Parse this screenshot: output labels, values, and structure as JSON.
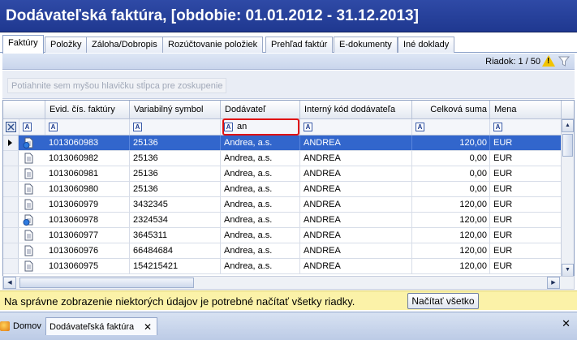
{
  "window": {
    "title": "Dodávateľská faktúra, [obdobie: 01.01.2012 - 31.12.2013]"
  },
  "tabs": [
    {
      "label": "Faktúry",
      "active": true
    },
    {
      "label": "Položky"
    },
    {
      "label": "Záloha/Dobropis"
    },
    {
      "label": "Rozúčtovanie položiek"
    },
    {
      "label": "Prehľad faktúr"
    },
    {
      "label": "E-dokumenty"
    },
    {
      "label": "Iné doklady"
    }
  ],
  "status": {
    "row_counter": "Riadok: 1 / 50"
  },
  "group_hint": "Potiahnite sem myšou hlavičku stĺpca pre zoskupenie",
  "grid": {
    "columns": [
      "Evid. čís. faktúry",
      "Variabilný symbol",
      "Dodávateľ",
      "Interný kód dodávateľa",
      "Celková suma",
      "Mena"
    ],
    "filter_value": "an",
    "filter_glyph": "A",
    "rows": [
      {
        "invoice": "1013060983",
        "vs": "25136",
        "supplier": "Andrea, a.s.",
        "code": "ANDREA",
        "sum": "120,00",
        "currency": "EUR",
        "icon": "doc-globe-icon",
        "selected": true
      },
      {
        "invoice": "1013060982",
        "vs": "25136",
        "supplier": "Andrea, a.s.",
        "code": "ANDREA",
        "sum": "0,00",
        "currency": "EUR",
        "icon": "doc-icon"
      },
      {
        "invoice": "1013060981",
        "vs": "25136",
        "supplier": "Andrea, a.s.",
        "code": "ANDREA",
        "sum": "0,00",
        "currency": "EUR",
        "icon": "doc-icon"
      },
      {
        "invoice": "1013060980",
        "vs": "25136",
        "supplier": "Andrea, a.s.",
        "code": "ANDREA",
        "sum": "0,00",
        "currency": "EUR",
        "icon": "doc-icon"
      },
      {
        "invoice": "1013060979",
        "vs": "3432345",
        "supplier": "Andrea, a.s.",
        "code": "ANDREA",
        "sum": "120,00",
        "currency": "EUR",
        "icon": "doc-icon"
      },
      {
        "invoice": "1013060978",
        "vs": "2324534",
        "supplier": "Andrea, a.s.",
        "code": "ANDREA",
        "sum": "120,00",
        "currency": "EUR",
        "icon": "doc-globe-icon"
      },
      {
        "invoice": "1013060977",
        "vs": "3645311",
        "supplier": "Andrea, a.s.",
        "code": "ANDREA",
        "sum": "120,00",
        "currency": "EUR",
        "icon": "doc-icon"
      },
      {
        "invoice": "1013060976",
        "vs": "66484684",
        "supplier": "Andrea, a.s.",
        "code": "ANDREA",
        "sum": "120,00",
        "currency": "EUR",
        "icon": "doc-icon"
      },
      {
        "invoice": "1013060975",
        "vs": "154215421",
        "supplier": "Andrea, a.s.",
        "code": "ANDREA",
        "sum": "120,00",
        "currency": "EUR",
        "icon": "doc-icon"
      }
    ]
  },
  "notice": {
    "text": "Na správne zobrazenie niektorých údajov je potrebné načítať všetky riadky.",
    "button": "Načítať všetko"
  },
  "bottom_tabs": [
    {
      "label": "Domov"
    },
    {
      "label": "Dodávateľská faktúra",
      "active": true
    }
  ],
  "close_glyph": "✕",
  "colors": {
    "title_bg": "#2f4aa6",
    "selection": "#3266cc",
    "notice_bg": "#fbf2a8",
    "filter_highlight": "#e01010"
  }
}
